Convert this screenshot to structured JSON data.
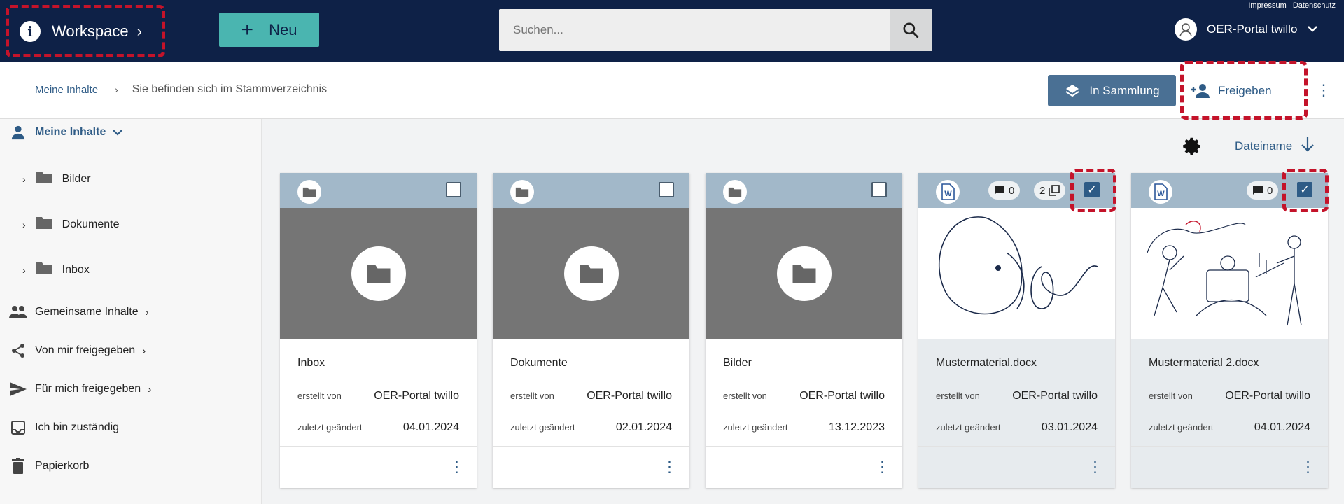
{
  "topbar": {
    "workspace_label": "Workspace",
    "new_label": "Neu",
    "search_placeholder": "Suchen...",
    "links": [
      "Impressum",
      "Datenschutz"
    ],
    "user_name": "OER-Portal twillo"
  },
  "actionbar": {
    "breadcrumb_home": "Meine Inhalte",
    "breadcrumb_current": "Sie befinden sich im Stammverzeichnis",
    "collection_label": "In Sammlung",
    "share_label": "Freigeben"
  },
  "sidebar": {
    "my_content": "Meine Inhalte",
    "folders": [
      "Bilder",
      "Dokumente",
      "Inbox"
    ],
    "items": [
      {
        "label": "Gemeinsame Inhalte",
        "icon": "group-icon"
      },
      {
        "label": "Von mir freigegeben",
        "icon": "share-icon"
      },
      {
        "label": "Für mich freigegeben",
        "icon": "send-icon"
      },
      {
        "label": "Ich bin zuständig",
        "icon": "inbox-icon"
      },
      {
        "label": "Papierkorb",
        "icon": "trash-icon"
      }
    ]
  },
  "sort": {
    "label": "Dateiname"
  },
  "cards": [
    {
      "title": "Inbox",
      "created_label": "erstellt von",
      "created_by": "OER-Portal twillo",
      "modified_label": "zuletzt geändert",
      "modified": "04.01.2024"
    },
    {
      "title": "Dokumente",
      "created_label": "erstellt von",
      "created_by": "OER-Portal twillo",
      "modified_label": "zuletzt geändert",
      "modified": "02.01.2024"
    },
    {
      "title": "Bilder",
      "created_label": "erstellt von",
      "created_by": "OER-Portal twillo",
      "modified_label": "zuletzt geändert",
      "modified": "13.12.2023"
    },
    {
      "title": "Mustermaterial.docx",
      "created_label": "erstellt von",
      "created_by": "OER-Portal twillo",
      "modified_label": "zuletzt geändert",
      "modified": "03.01.2024",
      "comments": "0",
      "collections": "2"
    },
    {
      "title": "Mustermaterial 2.docx",
      "created_label": "erstellt von",
      "created_by": "OER-Portal twillo",
      "modified_label": "zuletzt geändert",
      "modified": "04.01.2024",
      "comments": "0"
    }
  ],
  "colors": {
    "topbar": "#0e2147",
    "accent": "#4ab5b0",
    "primary": "#2e5b86",
    "highlight": "#c4132a"
  }
}
